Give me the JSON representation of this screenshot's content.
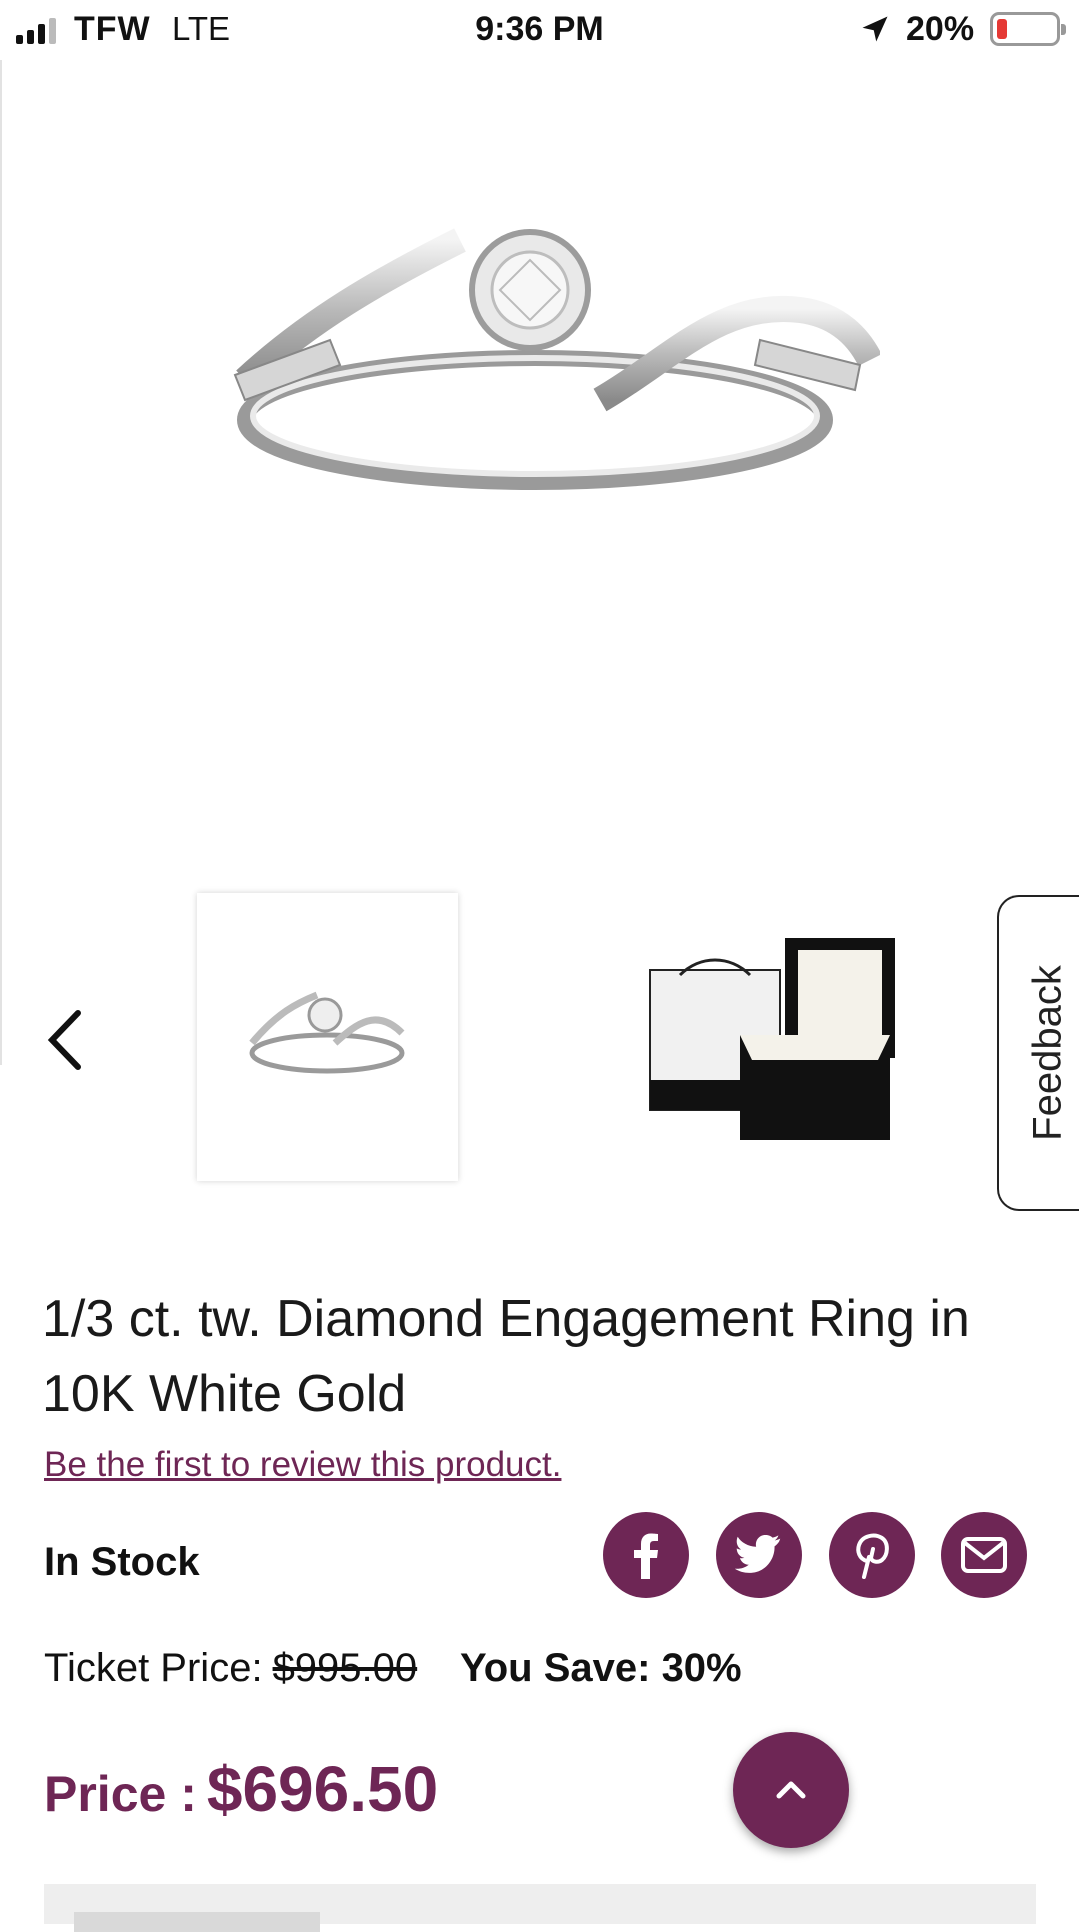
{
  "status_bar": {
    "carrier": "TFW",
    "network": "LTE",
    "time": "9:36 PM",
    "battery_percent": "20%",
    "battery_level": 0.2,
    "location_icon": "location-arrow-icon"
  },
  "gallery": {
    "prev_icon": "chevron-left-icon",
    "thumbnails": [
      "ring-thumbnail",
      "gift-box-thumbnail"
    ]
  },
  "feedback_tab": {
    "label": "Feedback"
  },
  "product": {
    "title": "1/3 ct. tw. Diamond Engagement Ring in 10K White Gold",
    "review_link": "Be the first to review this product.",
    "stock_status": "In Stock",
    "ticket_label": "Ticket Price:",
    "ticket_price": "$995.00",
    "save_label": "You Save:",
    "save_value": "30%",
    "price_label": "Price :",
    "price_value": "$696.50"
  },
  "share": {
    "icons": [
      "facebook-icon",
      "twitter-icon",
      "pinterest-icon",
      "email-icon"
    ]
  },
  "scroll_top": {
    "icon": "chevron-up-icon"
  },
  "colors": {
    "brand": "#6e2655",
    "text": "#111111"
  }
}
